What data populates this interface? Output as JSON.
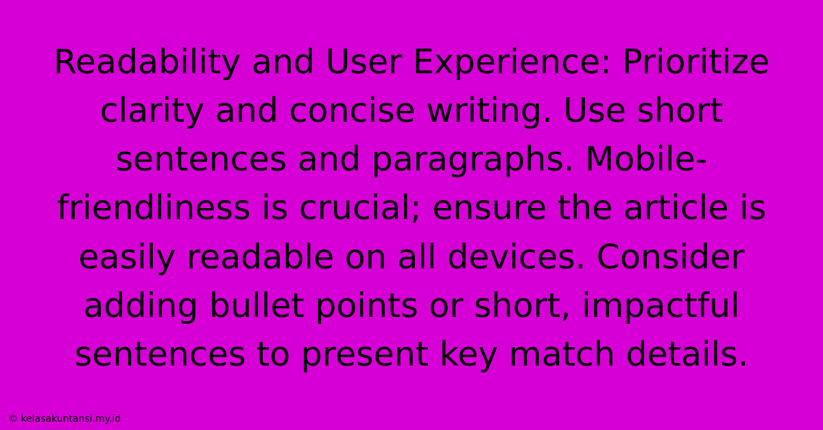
{
  "main": {
    "text": "Readability and User Experience: Prioritize clarity and concise writing. Use short sentences and paragraphs. Mobile-friendliness is crucial; ensure the article is easily readable on all devices.  Consider adding bullet points or short, impactful sentences to present key match details."
  },
  "footer": {
    "attribution": "© kelasakuntansi.my.id"
  }
}
